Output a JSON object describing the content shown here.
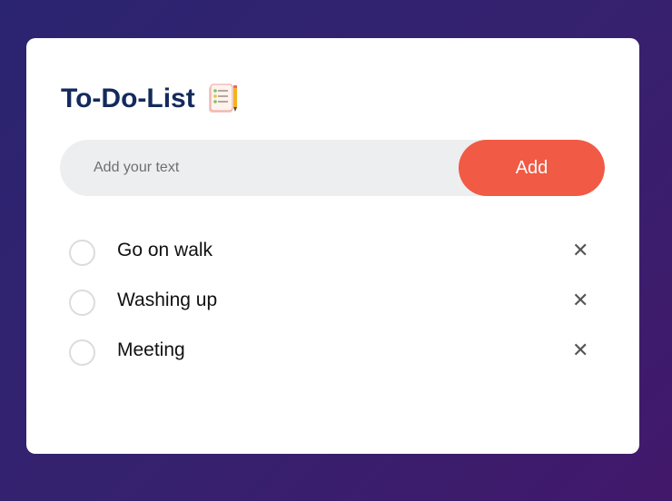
{
  "app": {
    "title": "To-Do-List",
    "title_icon": "notepad-checklist-icon"
  },
  "input": {
    "placeholder": "Add your text",
    "value": ""
  },
  "add_button": {
    "label": "Add"
  },
  "tasks": [
    {
      "text": "Go on walk",
      "done": false
    },
    {
      "text": "Washing up",
      "done": false
    },
    {
      "text": "Meeting",
      "done": false
    }
  ],
  "icons": {
    "delete": "close-icon",
    "checkbox": "circle-checkbox-icon"
  },
  "colors": {
    "accent": "#f15a44",
    "title": "#142a5c",
    "background_start": "#2b2470",
    "background_end": "#42186b"
  }
}
